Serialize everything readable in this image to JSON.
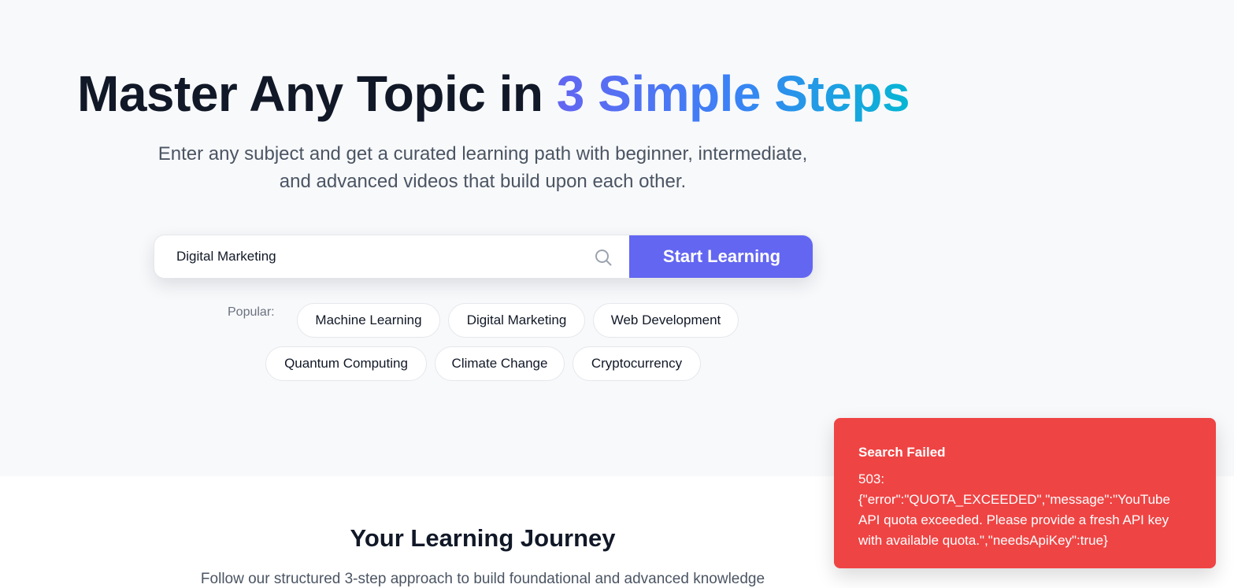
{
  "hero": {
    "title_plain": "Master Any Topic in ",
    "title_accent": "3 Simple Steps",
    "subtitle": "Enter any subject and get a curated learning path with beginner, intermediate, and advanced videos that build upon each other."
  },
  "search": {
    "value": "Digital Marketing",
    "button_label": "Start Learning"
  },
  "popular": {
    "label": "Popular:",
    "topics": [
      "Machine Learning",
      "Digital Marketing",
      "Web Development",
      "Quantum Computing",
      "Climate Change",
      "Cryptocurrency"
    ]
  },
  "journey": {
    "title": "Your Learning Journey",
    "subtitle": "Follow our structured 3-step approach to build foundational and advanced knowledge"
  },
  "toast": {
    "title": "Search Failed",
    "message": "503: {\"error\":\"QUOTA_EXCEEDED\",\"message\":\"YouTube API quota exceeded. Please provide a fresh API key with available quota.\",\"needsApiKey\":true}"
  },
  "colors": {
    "accent": "#6366f1",
    "toast_bg": "#ef4444",
    "hero_bg": "#f8f9fb"
  },
  "icons": {
    "search": "search-icon"
  }
}
